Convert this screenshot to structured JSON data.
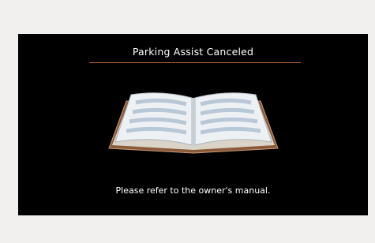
{
  "alert": {
    "title": "Parking Assist Canceled",
    "message": "Please refer to the owner's manual.",
    "icon": "open-book-icon"
  },
  "colors": {
    "page_background": "#f2f0ef",
    "screen_background": "#000000",
    "text": "#ffffff",
    "divider": "#b5683a",
    "book_cover": "#8a5a3b",
    "book_pages": "#e8ecf0",
    "book_text_lines": "#b9c8d6"
  }
}
